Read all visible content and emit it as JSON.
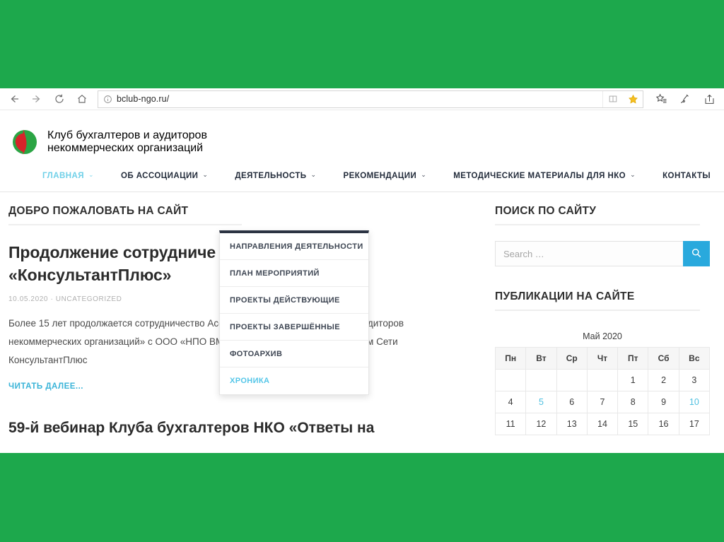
{
  "browser": {
    "back_label": "Back",
    "forward_label": "Forward",
    "refresh_label": "Refresh",
    "home_label": "Home",
    "url": "bclub-ngo.ru/",
    "reading_view_label": "Reading view",
    "favorite_label": "Add to favorites",
    "hub_label": "Hub",
    "notes_label": "Make a Web Note",
    "share_label": "Share"
  },
  "site": {
    "brand_line1": "Клуб бухгалтеров и аудиторов",
    "brand_line2": "некоммерческих организаций",
    "nav": [
      {
        "label": "ГЛАВНАЯ",
        "caret": "⌄",
        "active": true
      },
      {
        "label": "ОБ АССОЦИАЦИИ",
        "caret": "⌄",
        "active": false
      },
      {
        "label": "ДЕЯТЕЛЬНОСТЬ",
        "caret": "⌄",
        "active": false
      },
      {
        "label": "РЕКОМЕНДАЦИИ",
        "caret": "⌄",
        "active": false
      },
      {
        "label": "МЕТОДИЧЕСКИЕ МАТЕРИАЛЫ ДЛЯ НКО",
        "caret": "⌄",
        "active": false
      },
      {
        "label": "КОНТАКТЫ",
        "caret": "",
        "active": false
      }
    ],
    "dropdown": {
      "parent": "ДЕЯТЕЛЬНОСТЬ",
      "items": [
        {
          "label": "НАПРАВЛЕНИЯ ДЕЯТЕЛЬНОСТИ",
          "hover": false
        },
        {
          "label": "ПЛАН МЕРОПРИЯТИЙ",
          "hover": false
        },
        {
          "label": "ПРОЕКТЫ ДЕЙСТВУЮЩИЕ",
          "hover": false
        },
        {
          "label": "ПРОЕКТЫ ЗАВЕРШЁННЫЕ",
          "hover": false
        },
        {
          "label": "ФОТОАРХИВ",
          "hover": false
        },
        {
          "label": "ХРОНИКА",
          "hover": true
        }
      ]
    }
  },
  "content": {
    "section_title": "ДОБРО ПОЖАЛОВАТЬ НА САЙТ",
    "post1": {
      "title": "Продолжение сотрудничества с ООО «НПО ВМИ» — «КонсультантПлюс»",
      "title_line1": "Продолжение сотрудниче",
      "title_line2": "«КонсультантПлюс»",
      "date": "10.05.2020",
      "meta_sep": "·",
      "category": "UNCATEGORIZED",
      "excerpt_line1": "Более 15 лет продолжается сотрудничество Ассоциации «Клуб бухгалтеров и аудиторов некоммерческих",
      "excerpt_line2": "организаций» с ООО «НПО ВМИ» — Координационным центром Сети КонсультантПлюс",
      "read_more": "ЧИТАТЬ ДАЛЕЕ..."
    },
    "post2": {
      "title": "59-й вебинар Клуба бухгалтеров НКО «Ответы на"
    }
  },
  "sidebar": {
    "search": {
      "title": "ПОИСК ПО САЙТУ",
      "placeholder": "Search …",
      "value": "",
      "button_icon": "search-icon"
    },
    "publications": {
      "title": "ПУБЛИКАЦИИ НА САЙТЕ"
    },
    "calendar": {
      "caption": "Май 2020",
      "weekdays": [
        "Пн",
        "Вт",
        "Ср",
        "Чт",
        "Пт",
        "Сб",
        "Вс"
      ],
      "weeks": [
        [
          {
            "d": "",
            "link": false
          },
          {
            "d": "",
            "link": false
          },
          {
            "d": "",
            "link": false
          },
          {
            "d": "",
            "link": false
          },
          {
            "d": "1",
            "link": false
          },
          {
            "d": "2",
            "link": false
          },
          {
            "d": "3",
            "link": false
          }
        ],
        [
          {
            "d": "4",
            "link": false
          },
          {
            "d": "5",
            "link": true
          },
          {
            "d": "6",
            "link": false
          },
          {
            "d": "7",
            "link": false
          },
          {
            "d": "8",
            "link": false
          },
          {
            "d": "9",
            "link": false
          },
          {
            "d": "10",
            "link": true
          }
        ],
        [
          {
            "d": "11",
            "link": false
          },
          {
            "d": "12",
            "link": false
          },
          {
            "d": "13",
            "link": false
          },
          {
            "d": "14",
            "link": false
          },
          {
            "d": "15",
            "link": false
          },
          {
            "d": "16",
            "link": false
          },
          {
            "d": "17",
            "link": false
          }
        ]
      ]
    }
  },
  "colors": {
    "backdrop_green": "#1da84c",
    "accent_cyan": "#4fc0e0",
    "search_button_blue": "#29a9dd",
    "nav_text_dark": "#232c3b",
    "dropdown_top_bar": "#2b3342",
    "logo_red": "#d8232a",
    "logo_green": "#2ba544"
  }
}
